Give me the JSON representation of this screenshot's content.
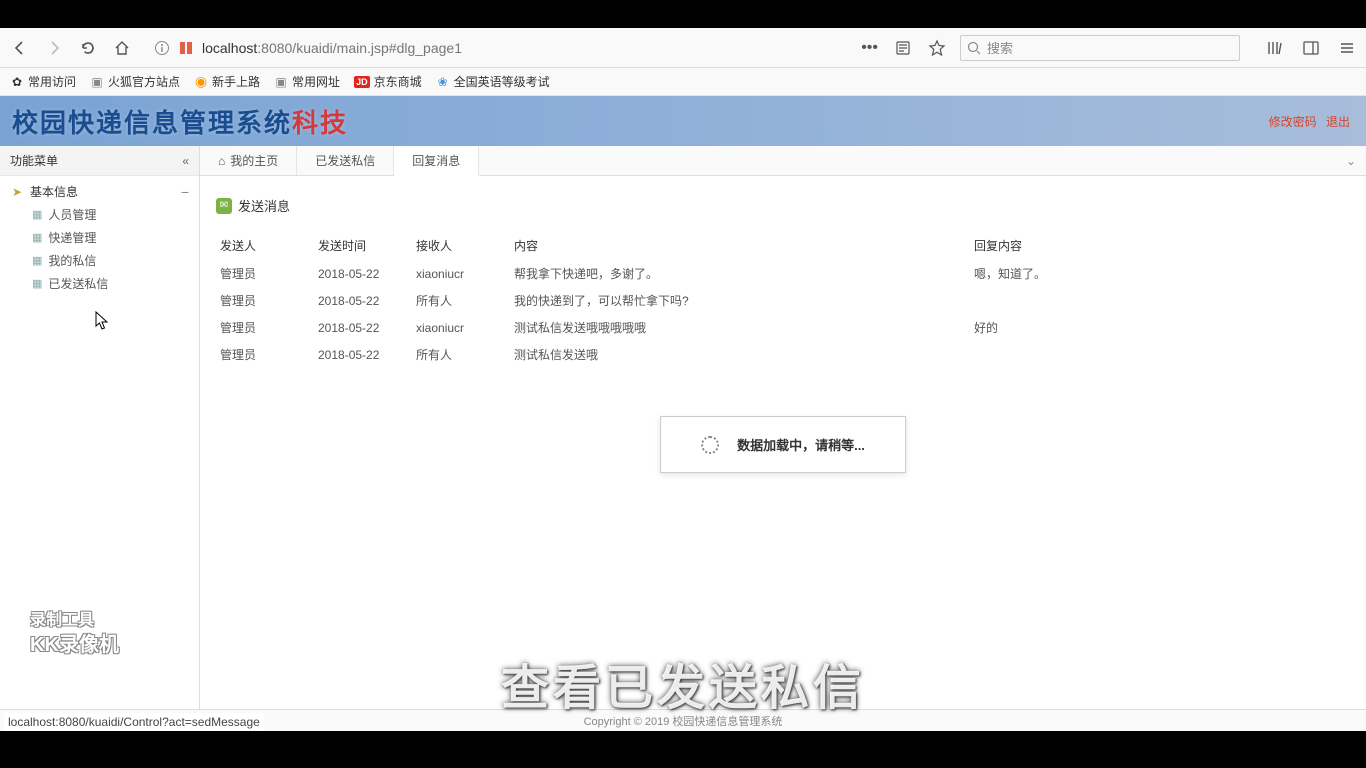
{
  "browser": {
    "url_pre": "localhost",
    "url_rest": ":8080/kuaidi/main.jsp#dlg_page1",
    "search_placeholder": "搜索"
  },
  "bookmarks": {
    "frequent": "常用访问",
    "firefox_official": "火狐官方站点",
    "newbie": "新手上路",
    "common": "常用网址",
    "jd": "京东商城",
    "cet": "全国英语等级考试"
  },
  "app": {
    "title_main": "校园快递信息管理系统",
    "title_suffix": "科技",
    "header_link1": "修改密码",
    "header_link2": "退出"
  },
  "sidebar": {
    "title": "功能菜单",
    "group": "基本信息",
    "items": [
      "人员管理",
      "快递管理",
      "我的私信",
      "已发送私信"
    ]
  },
  "tabs": {
    "home": "我的主页",
    "sent": "已发送私信",
    "reply": "回复消息"
  },
  "panel": {
    "title": "发送消息",
    "headers": {
      "sender": "发送人",
      "time": "发送时间",
      "recv": "接收人",
      "content": "内容",
      "reply": "回复内容"
    },
    "rows": [
      {
        "sender": "管理员",
        "time": "2018-05-22",
        "recv": "xiaoniucr",
        "content": "帮我拿下快递吧，多谢了。",
        "reply": "嗯，知道了。"
      },
      {
        "sender": "管理员",
        "time": "2018-05-22",
        "recv": "所有人",
        "content": "我的快递到了，可以帮忙拿下吗?",
        "reply": ""
      },
      {
        "sender": "管理员",
        "time": "2018-05-22",
        "recv": "xiaoniucr",
        "content": "测试私信发送哦哦哦哦哦",
        "reply": "好的"
      },
      {
        "sender": "管理员",
        "time": "2018-05-22",
        "recv": "所有人",
        "content": "测试私信发送哦",
        "reply": ""
      }
    ]
  },
  "loading": "数据加载中，请稍等...",
  "footer": "Copyright © 2019 校园快递信息管理系统",
  "status": "localhost:8080/kuaidi/Control?act=sedMessage",
  "watermark": {
    "line1": "录制工具",
    "line2": "KK录像机"
  },
  "caption": "查看已发送私信"
}
